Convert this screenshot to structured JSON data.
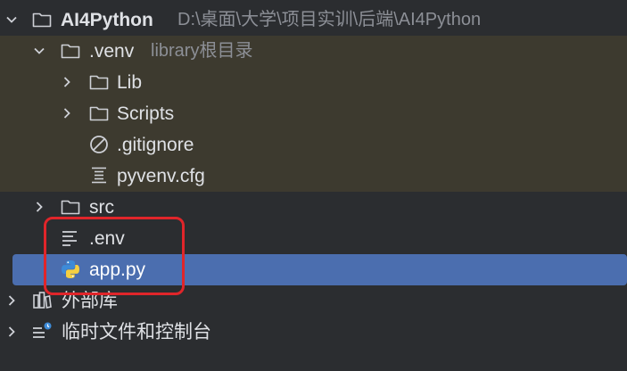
{
  "tree": {
    "root": {
      "label": "AI4Python",
      "path": "D:\\桌面\\大学\\项目实训\\后端\\AI4Python"
    },
    "venv": {
      "label": ".venv",
      "hint": "library根目录"
    },
    "lib": {
      "label": "Lib"
    },
    "scripts": {
      "label": "Scripts"
    },
    "gitignore": {
      "label": ".gitignore"
    },
    "pyvenv": {
      "label": "pyvenv.cfg"
    },
    "src": {
      "label": "src"
    },
    "env": {
      "label": ".env"
    },
    "app": {
      "label": "app.py"
    },
    "external": {
      "label": "外部库"
    },
    "scratches": {
      "label": "临时文件和控制台"
    }
  },
  "icons": {
    "chevron": "chevron-icon",
    "folder": "folder-icon",
    "ignore": "ignore-file-icon",
    "config": "config-file-icon",
    "text": "text-file-icon",
    "python": "python-file-icon",
    "library": "library-icon",
    "scratch": "scratch-console-icon"
  },
  "colors": {
    "background": "#2b2d30",
    "excluded_background": "#3d3a2f",
    "selection": "#4b6eaf",
    "annotation": "#e0252a"
  }
}
